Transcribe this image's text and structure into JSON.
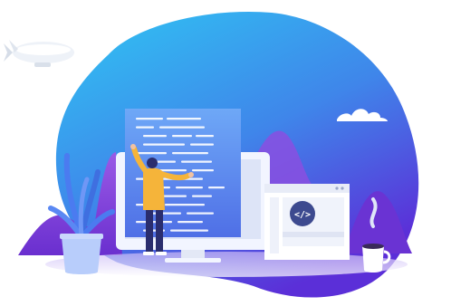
{
  "illustration": {
    "code_badge": {
      "glyph": "</>",
      "icon": "code-icon"
    },
    "elements": [
      "blob-background",
      "blimp",
      "cloud",
      "monitor",
      "code-panel",
      "browser-window",
      "developer-person",
      "plant-pot",
      "coffee-cup",
      "mountains"
    ]
  },
  "colors": {
    "blob_top": "#2fc6f3",
    "blob_bottom": "#5b2fd8",
    "mountain": "#7a3fd6",
    "shirt": "#f5b43a",
    "pants": "#2a2d6e",
    "plant_leaf": "#4b7bf0",
    "pot": "#b8cdfb",
    "monitor_frame": "#f2f5ff",
    "panel": "#5d8ff2"
  }
}
